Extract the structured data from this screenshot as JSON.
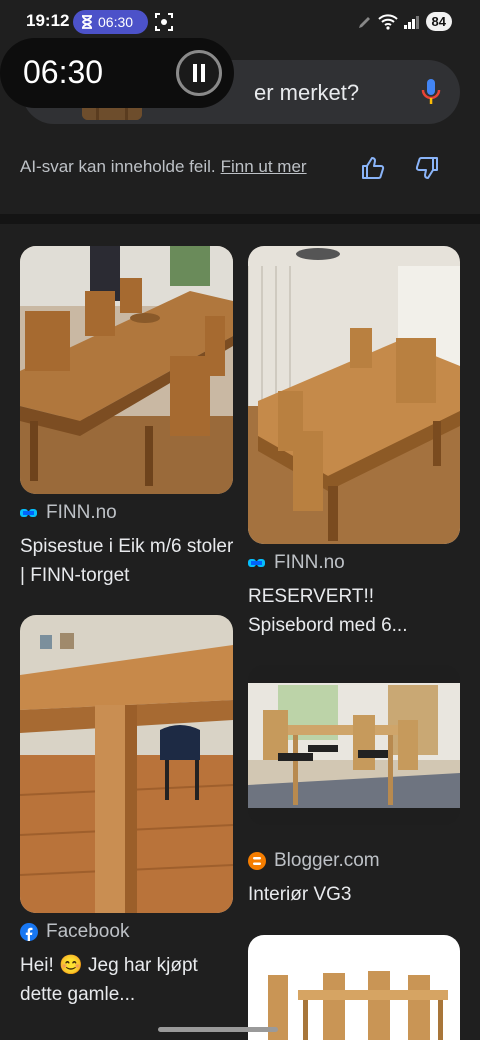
{
  "status_bar": {
    "time": "19:12",
    "timer": "06:30",
    "battery": "84"
  },
  "search": {
    "text": "er merket?"
  },
  "timer_overlay": {
    "time": "06:30"
  },
  "ai_notice": {
    "text": "AI-svar kan inneholde feil.",
    "link": "Finn ut mer"
  },
  "results": [
    {
      "source": "FINN.no",
      "title": "Spisestue i Eik m/6 stoler | FINN-torget",
      "source_icon": "finn-icon"
    },
    {
      "source": "FINN.no",
      "title": "RESERVERT!! Spisebord med 6...",
      "source_icon": "finn-icon"
    },
    {
      "source": "Facebook",
      "title": "Hei! 😊 Jeg har kjøpt dette gamle...",
      "source_icon": "facebook-icon"
    },
    {
      "source": "Blogger.com",
      "title": "Interiør VG3",
      "source_icon": "blogger-icon"
    }
  ],
  "colors": {
    "background": "#1f1f1f",
    "timer_pill": "#4c52c9",
    "link": "#bdc1c6",
    "blogger": "#f57d00",
    "facebook": "#1877f2",
    "finn": "#06befb"
  }
}
